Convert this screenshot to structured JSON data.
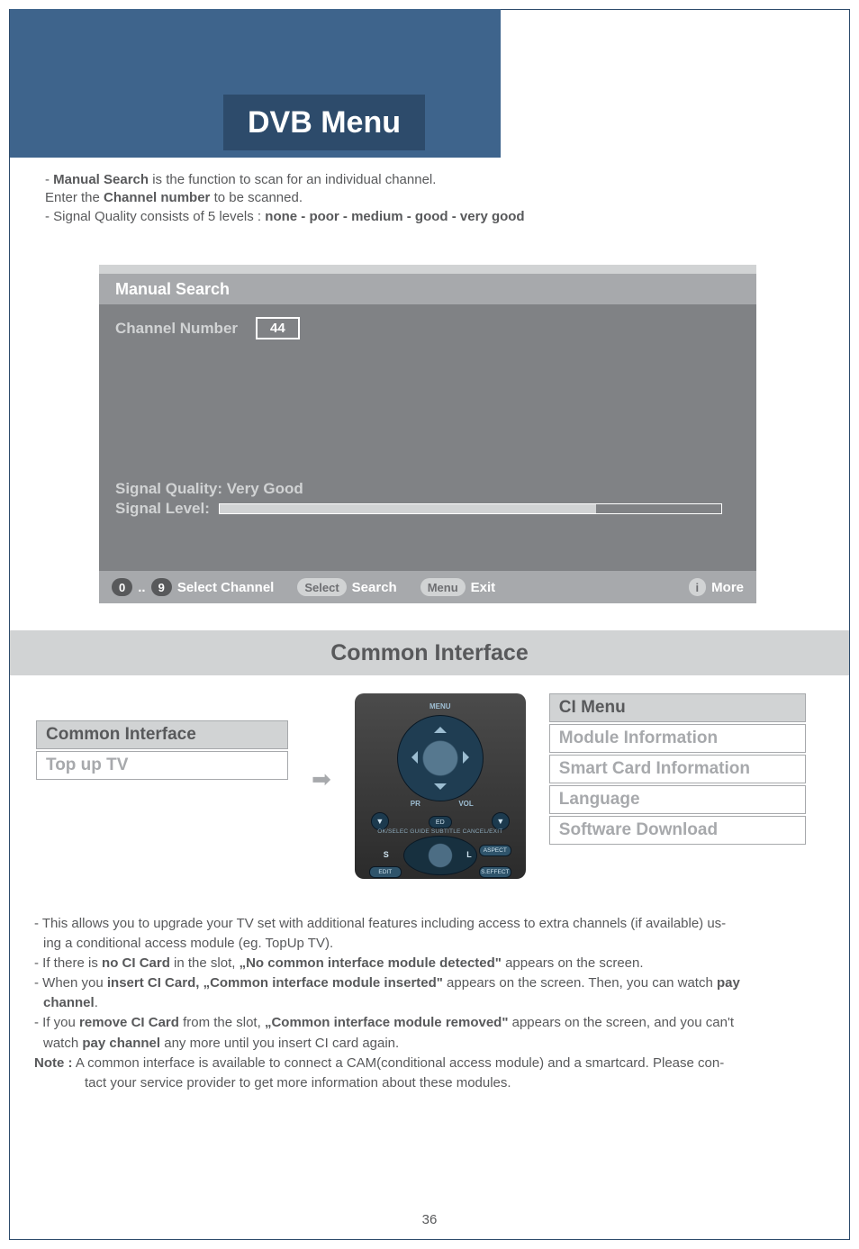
{
  "page_title": "DVB Menu",
  "intro": {
    "l1_pre": "- ",
    "l1_b1": "Manual Search",
    "l1_mid": " is the function to scan for an individual channel.",
    "l2_pre": "   Enter the ",
    "l2_b1": "Channel number",
    "l2_post": " to be scanned.",
    "l3_pre": "- Signal Quality consists of 5 levels :  ",
    "l3_b1": "none - poor - medium - good - very good"
  },
  "manual_search": {
    "header": "Manual Search",
    "channel_number_label": "Channel Number",
    "channel_number_value": "44",
    "signal_quality": "Signal Quality: Very Good",
    "signal_level_label": "Signal Level:",
    "footer": {
      "key_0": "0",
      "key_dots": "..",
      "key_9": "9",
      "select_channel": "Select Channel",
      "select_key": "Select",
      "search": "Search",
      "menu_key": "Menu",
      "exit": "Exit",
      "info_key": "i",
      "more": "More"
    }
  },
  "ci_section_title": "Common Interface",
  "ci_left": {
    "header": "Common Interface",
    "item1": "Top up TV"
  },
  "remote": {
    "menu": "MENU",
    "pr": "PR",
    "vol": "VOL",
    "ed": "ED",
    "row": "OK/SELEC   GUIDE    SUBTITLE CANCEL/EXIT",
    "aspect": "ASPECT",
    "edit": "EDIT",
    "seffect": "S.EFFECT",
    "s": "S",
    "l": "L",
    "down_glyph": "▼"
  },
  "ci_right": {
    "header": "CI Menu",
    "item1": "Module Information",
    "item2": "Smart Card Information",
    "item3": "Language",
    "item4": "Software Download"
  },
  "notes": {
    "n1a": "- This allows you to upgrade your TV set with additional features including access to extra channels (if available) us-",
    "n1b": "ing a conditional access module (eg. TopUp TV).",
    "n2_pre": "- If there is ",
    "n2_b1": "no CI Card",
    "n2_mid": " in the slot, ",
    "n2_b2": "„No common interface module detected\"",
    "n2_post": " appears on the screen.",
    "n3_pre": "- When you ",
    "n3_b1": "insert CI Card, „Common interface module inserted\"",
    "n3_mid": " appears on the screen. Then, you can watch ",
    "n3_b2": "pay",
    "n3_line2_b": "channel",
    "n3_line2_post": ".",
    "n4_pre": "- If you ",
    "n4_b1": "remove CI Card",
    "n4_mid": " from the slot, ",
    "n4_b2": "„Common interface module removed\"",
    "n4_post": " appears on the screen, and you can't",
    "n4_line2_pre": "watch ",
    "n4_line2_b": "pay channel",
    "n4_line2_post": " any more until you insert CI card again.",
    "note_b": "Note  :",
    "note_l1": " A common interface is available to connect a CAM(conditional access module) and a smartcard. Please con-",
    "note_l2": "tact your service provider to get more information about these modules."
  },
  "page_number": "36"
}
